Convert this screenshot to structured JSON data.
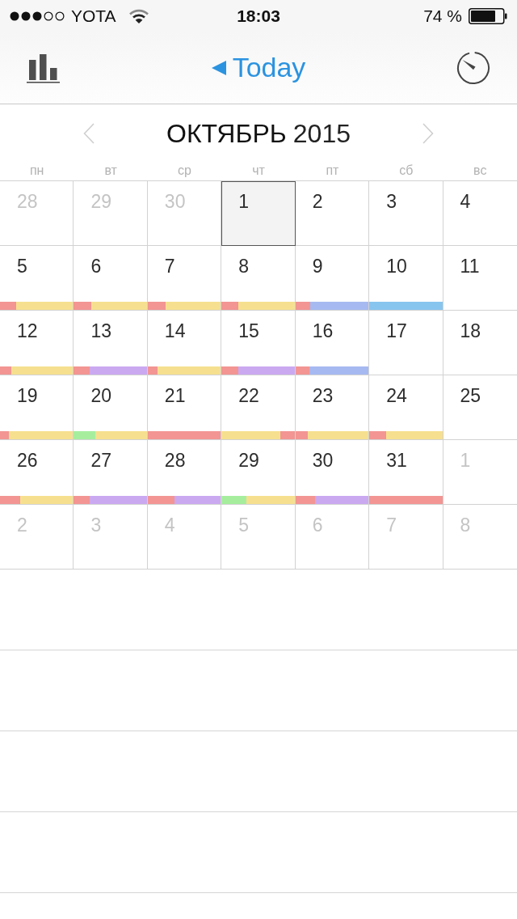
{
  "status_bar": {
    "carrier": "YOTA",
    "time": "18:03",
    "battery": "74 %"
  },
  "nav_bar": {
    "today_button": "Today"
  },
  "month_header": {
    "month": "ОКТЯБРЬ",
    "year": "2015"
  },
  "weekdays": [
    "пн",
    "вт",
    "ср",
    "чт",
    "пт",
    "сб",
    "вс"
  ],
  "weeks": [
    {
      "days": [
        {
          "day": "28",
          "outside_month": true,
          "selected": false
        },
        {
          "day": "29",
          "outside_month": true,
          "selected": false
        },
        {
          "day": "30",
          "outside_month": true,
          "selected": false
        },
        {
          "day": "1",
          "outside_month": false,
          "selected": true
        },
        {
          "day": "2",
          "outside_month": false,
          "selected": false
        },
        {
          "day": "3",
          "outside_month": false,
          "selected": false
        },
        {
          "day": "4",
          "outside_month": false,
          "selected": false
        }
      ]
    },
    {
      "days": [
        {
          "day": "5",
          "outside_month": false,
          "selected": false,
          "segments": [
            {
              "color": "#f29593",
              "level": 0.22
            },
            {
              "color": "#f6e08f",
              "level": 0.78
            }
          ]
        },
        {
          "day": "6",
          "outside_month": false,
          "selected": false,
          "segments": [
            {
              "color": "#f29593",
              "level": 0.24
            },
            {
              "color": "#f6e08f",
              "level": 0.76
            }
          ]
        },
        {
          "day": "7",
          "outside_month": false,
          "selected": false,
          "segments": [
            {
              "color": "#f29593",
              "level": 0.25
            },
            {
              "color": "#f6e08f",
              "level": 0.75
            }
          ]
        },
        {
          "day": "8",
          "outside_month": false,
          "selected": false,
          "segments": [
            {
              "color": "#f29593",
              "level": 0.23
            },
            {
              "color": "#f6e08f",
              "level": 0.77
            }
          ]
        },
        {
          "day": "9",
          "outside_month": false,
          "selected": false,
          "segments": [
            {
              "color": "#f29593",
              "level": 0.2
            },
            {
              "color": "#a6b9f1",
              "level": 0.8
            }
          ]
        },
        {
          "day": "10",
          "outside_month": false,
          "selected": false,
          "segments": [
            {
              "color": "#87c5ef",
              "level": 1
            }
          ]
        },
        {
          "day": "11",
          "outside_month": false,
          "selected": false
        }
      ]
    },
    {
      "days": [
        {
          "day": "12",
          "outside_month": false,
          "selected": false,
          "segments": [
            {
              "color": "#f29593",
              "level": 0.16
            },
            {
              "color": "#f6e08f",
              "level": 0.84
            }
          ]
        },
        {
          "day": "13",
          "outside_month": false,
          "selected": false,
          "segments": [
            {
              "color": "#f29593",
              "level": 0.22
            },
            {
              "color": "#cba9f1",
              "level": 0.78
            }
          ]
        },
        {
          "day": "14",
          "outside_month": false,
          "selected": false,
          "segments": [
            {
              "color": "#f29593",
              "level": 0.13
            },
            {
              "color": "#f6e08f",
              "level": 0.87
            }
          ]
        },
        {
          "day": "15",
          "outside_month": false,
          "selected": false,
          "segments": [
            {
              "color": "#f29593",
              "level": 0.23
            },
            {
              "color": "#cba9f1",
              "level": 0.77
            }
          ]
        },
        {
          "day": "16",
          "outside_month": false,
          "selected": false,
          "segments": [
            {
              "color": "#f29593",
              "level": 0.19
            },
            {
              "color": "#a6b9f1",
              "level": 0.81
            }
          ]
        },
        {
          "day": "17",
          "outside_month": false,
          "selected": false
        },
        {
          "day": "18",
          "outside_month": false,
          "selected": false
        }
      ]
    },
    {
      "days": [
        {
          "day": "19",
          "outside_month": false,
          "selected": false,
          "segments": [
            {
              "color": "#f29593",
              "level": 0.12
            },
            {
              "color": "#f6e08f",
              "level": 0.88
            }
          ]
        },
        {
          "day": "20",
          "outside_month": false,
          "selected": false,
          "segments": [
            {
              "color": "#a6ee9e",
              "level": 0.29
            },
            {
              "color": "#f6e08f",
              "level": 0.71
            }
          ]
        },
        {
          "day": "21",
          "outside_month": false,
          "selected": false,
          "segments": [
            {
              "color": "#f29593",
              "level": 1
            }
          ]
        },
        {
          "day": "22",
          "outside_month": false,
          "selected": false,
          "segments": [
            {
              "color": "#f6e08f",
              "level": 0.8
            },
            {
              "color": "#f29593",
              "level": 0.2
            }
          ]
        },
        {
          "day": "23",
          "outside_month": false,
          "selected": false,
          "segments": [
            {
              "color": "#f29593",
              "level": 0.17
            },
            {
              "color": "#f6e08f",
              "level": 0.83
            }
          ]
        },
        {
          "day": "24",
          "outside_month": false,
          "selected": false,
          "segments": [
            {
              "color": "#f29593",
              "level": 0.23
            },
            {
              "color": "#f6e08f",
              "level": 0.77
            }
          ]
        },
        {
          "day": "25",
          "outside_month": false,
          "selected": false
        }
      ]
    },
    {
      "days": [
        {
          "day": "26",
          "outside_month": false,
          "selected": false,
          "segments": [
            {
              "color": "#f29593",
              "level": 0.28
            },
            {
              "color": "#f6e08f",
              "level": 0.72
            }
          ]
        },
        {
          "day": "27",
          "outside_month": false,
          "selected": false,
          "segments": [
            {
              "color": "#f29593",
              "level": 0.22
            },
            {
              "color": "#cba9f1",
              "level": 0.78
            }
          ]
        },
        {
          "day": "28",
          "outside_month": false,
          "selected": false,
          "segments": [
            {
              "color": "#f29593",
              "level": 0.37
            },
            {
              "color": "#cba9f1",
              "level": 0.63
            }
          ]
        },
        {
          "day": "29",
          "outside_month": false,
          "selected": false,
          "segments": [
            {
              "color": "#a6ee9e",
              "level": 0.34
            },
            {
              "color": "#f6e08f",
              "level": 0.66
            }
          ]
        },
        {
          "day": "30",
          "outside_month": false,
          "selected": false,
          "segments": [
            {
              "color": "#f29593",
              "level": 0.27
            },
            {
              "color": "#cba9f1",
              "level": 0.73
            }
          ]
        },
        {
          "day": "31",
          "outside_month": false,
          "selected": false,
          "segments": [
            {
              "color": "#f29593",
              "level": 1
            }
          ]
        },
        {
          "day": "1",
          "outside_month": true,
          "selected": false
        }
      ]
    },
    {
      "days": [
        {
          "day": "2",
          "outside_month": true,
          "selected": false
        },
        {
          "day": "3",
          "outside_month": true,
          "selected": false
        },
        {
          "day": "4",
          "outside_month": true,
          "selected": false
        },
        {
          "day": "5",
          "outside_month": true,
          "selected": false
        },
        {
          "day": "6",
          "outside_month": true,
          "selected": false
        },
        {
          "day": "7",
          "outside_month": true,
          "selected": false
        },
        {
          "day": "8",
          "outside_month": true,
          "selected": false
        }
      ]
    }
  ]
}
